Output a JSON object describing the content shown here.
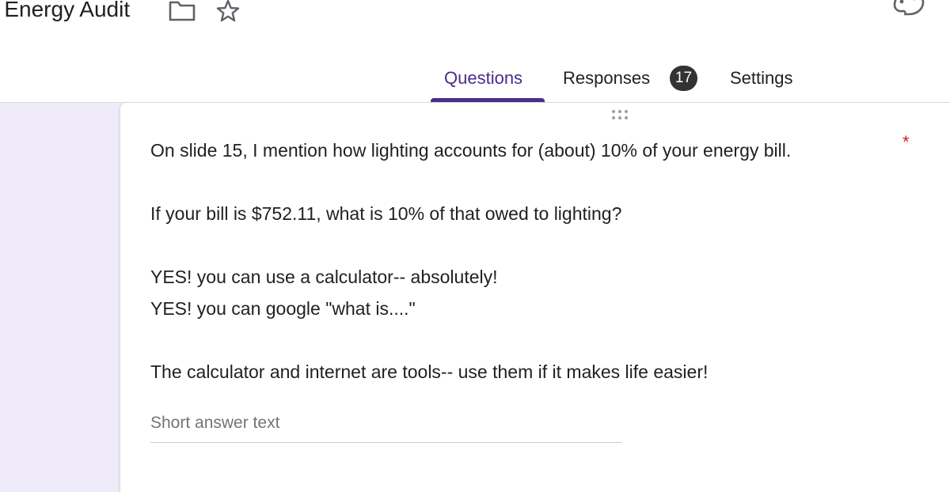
{
  "header": {
    "form_title": "e Energy Audit",
    "icons": {
      "folder": "folder-icon",
      "star": "star-icon",
      "palette": "palette-icon"
    }
  },
  "tabs": {
    "questions": "Questions",
    "responses": "Responses",
    "responses_count": "17",
    "settings": "Settings",
    "active": "Questions",
    "accent_color": "#4a2c8a"
  },
  "question": {
    "lines": [
      "On slide 15, I mention how lighting accounts for (about) 10% of your energy bill.",
      "",
      "If your bill is $752.11,  what is 10% of that owed to lighting?",
      "",
      "YES! you can use a calculator-- absolutely!",
      "YES! you can google \"what is....\"",
      "",
      "The calculator and internet are tools-- use them if it makes life easier!"
    ],
    "required_marker": "*",
    "required_color": "#c5221f",
    "answer_placeholder": "Short answer text"
  },
  "colors": {
    "canvas_background": "#f0ebf8",
    "card_background": "#ffffff"
  }
}
